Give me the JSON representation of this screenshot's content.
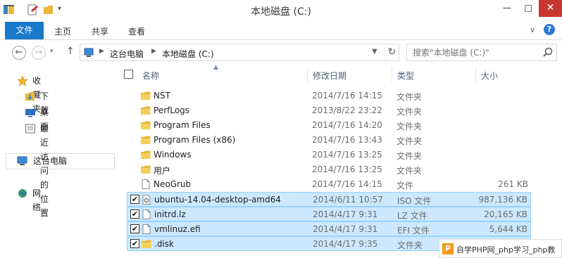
{
  "window": {
    "title": "本地磁盘 (C:)",
    "minimize_label": "—",
    "maximize_label": "□",
    "close_label": "✕"
  },
  "ribbon": {
    "file_tab": "文件",
    "tabs": [
      "主页",
      "共享",
      "查看"
    ],
    "expand_label": "∨",
    "help_label": "?"
  },
  "address": {
    "crumbs": [
      "这台电脑",
      "本地磁盘 (C:)"
    ],
    "refresh_label": "↻"
  },
  "search": {
    "placeholder": "搜索\"本地磁盘 (C:)\""
  },
  "nav_pane": {
    "favorites": "收藏夹",
    "favorite_items": [
      "下载",
      "桌面",
      "最近访问的位置"
    ],
    "this_pc": "这台电脑",
    "network": "网络"
  },
  "columns": {
    "name": "名称",
    "date": "修改日期",
    "type": "类型",
    "size": "大小"
  },
  "files": [
    {
      "name": "NST",
      "date": "2014/7/16 14:15",
      "type": "文件夹",
      "size": "",
      "kind": "folder",
      "selected": false
    },
    {
      "name": "PerfLogs",
      "date": "2013/8/22 23:22",
      "type": "文件夹",
      "size": "",
      "kind": "folder",
      "selected": false
    },
    {
      "name": "Program Files",
      "date": "2014/7/16 14:20",
      "type": "文件夹",
      "size": "",
      "kind": "folder",
      "selected": false
    },
    {
      "name": "Program Files (x86)",
      "date": "2014/7/16 13:43",
      "type": "文件夹",
      "size": "",
      "kind": "folder",
      "selected": false
    },
    {
      "name": "Windows",
      "date": "2014/7/16 13:25",
      "type": "文件夹",
      "size": "",
      "kind": "folder",
      "selected": false
    },
    {
      "name": "用户",
      "date": "2014/7/16 13:25",
      "type": "文件夹",
      "size": "",
      "kind": "folder",
      "selected": false
    },
    {
      "name": "NeoGrub",
      "date": "2014/7/16 14:15",
      "type": "文件",
      "size": "261 KB",
      "kind": "file",
      "selected": false
    },
    {
      "name": "ubuntu-14.04-desktop-amd64",
      "date": "2014/6/11 10:57",
      "type": "ISO 文件",
      "size": "987,136 KB",
      "kind": "iso",
      "selected": true
    },
    {
      "name": "initrd.lz",
      "date": "2014/4/17 9:31",
      "type": "LZ 文件",
      "size": "20,165 KB",
      "kind": "file",
      "selected": true
    },
    {
      "name": "vmlinuz.efi",
      "date": "2014/4/17 9:31",
      "type": "EFI 文件",
      "size": "5,644 KB",
      "kind": "file",
      "selected": true
    },
    {
      "name": ".disk",
      "date": "2014/4/17 9:35",
      "type": "文件夹",
      "size": "",
      "kind": "folder",
      "selected": true
    }
  ],
  "watermark": {
    "logo": "P",
    "text": "自学PHP网_php学习_php教"
  },
  "colors": {
    "accent": "#1979ca",
    "selection": "#cce8ff",
    "selection_border": "#99d1ff",
    "folder": "#e8b83a",
    "close": "#c7372f"
  }
}
